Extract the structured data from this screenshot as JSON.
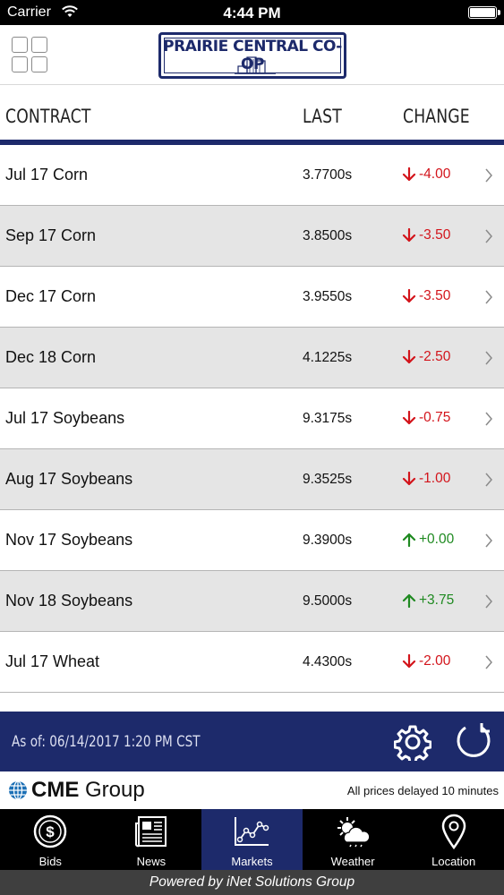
{
  "status_bar": {
    "carrier": "Carrier",
    "time": "4:44 PM"
  },
  "header": {
    "logo_text": "PRAIRIE CENTRAL CO-OP"
  },
  "columns": {
    "contract": "CONTRACT",
    "last": "LAST",
    "change": "CHANGE"
  },
  "rows": [
    {
      "contract": "Jul 17 Corn",
      "last": "3.7700s",
      "change": "-4.00",
      "direction": "down"
    },
    {
      "contract": "Sep 17 Corn",
      "last": "3.8500s",
      "change": "-3.50",
      "direction": "down"
    },
    {
      "contract": "Dec 17 Corn",
      "last": "3.9550s",
      "change": "-3.50",
      "direction": "down"
    },
    {
      "contract": "Dec 18 Corn",
      "last": "4.1225s",
      "change": "-2.50",
      "direction": "down"
    },
    {
      "contract": "Jul 17 Soybeans",
      "last": "9.3175s",
      "change": "-0.75",
      "direction": "down"
    },
    {
      "contract": "Aug 17 Soybeans",
      "last": "9.3525s",
      "change": "-1.00",
      "direction": "down"
    },
    {
      "contract": "Nov 17 Soybeans",
      "last": "9.3900s",
      "change": "+0.00",
      "direction": "up"
    },
    {
      "contract": "Nov 18 Soybeans",
      "last": "9.5000s",
      "change": "+3.75",
      "direction": "up"
    },
    {
      "contract": "Jul 17 Wheat",
      "last": "4.4300s",
      "change": "-2.00",
      "direction": "down"
    }
  ],
  "footer": {
    "as_of": "As of: 06/14/2017 1:20 PM CST"
  },
  "cme": {
    "brand_bold": "CME",
    "brand_rest": " Group",
    "delayed_note": "All prices delayed 10 minutes"
  },
  "tabs": [
    {
      "label": "Bids",
      "icon": "dollar-icon",
      "active": false
    },
    {
      "label": "News",
      "icon": "newspaper-icon",
      "active": false
    },
    {
      "label": "Markets",
      "icon": "chart-icon",
      "active": true
    },
    {
      "label": "Weather",
      "icon": "weather-icon",
      "active": false
    },
    {
      "label": "Location",
      "icon": "location-pin-icon",
      "active": false
    }
  ],
  "powered_by": "Powered by iNet Solutions Group",
  "colors": {
    "navy": "#1d2a6b",
    "down": "#d3141b",
    "up": "#1f8a21",
    "alt_row": "#e5e5e5"
  }
}
